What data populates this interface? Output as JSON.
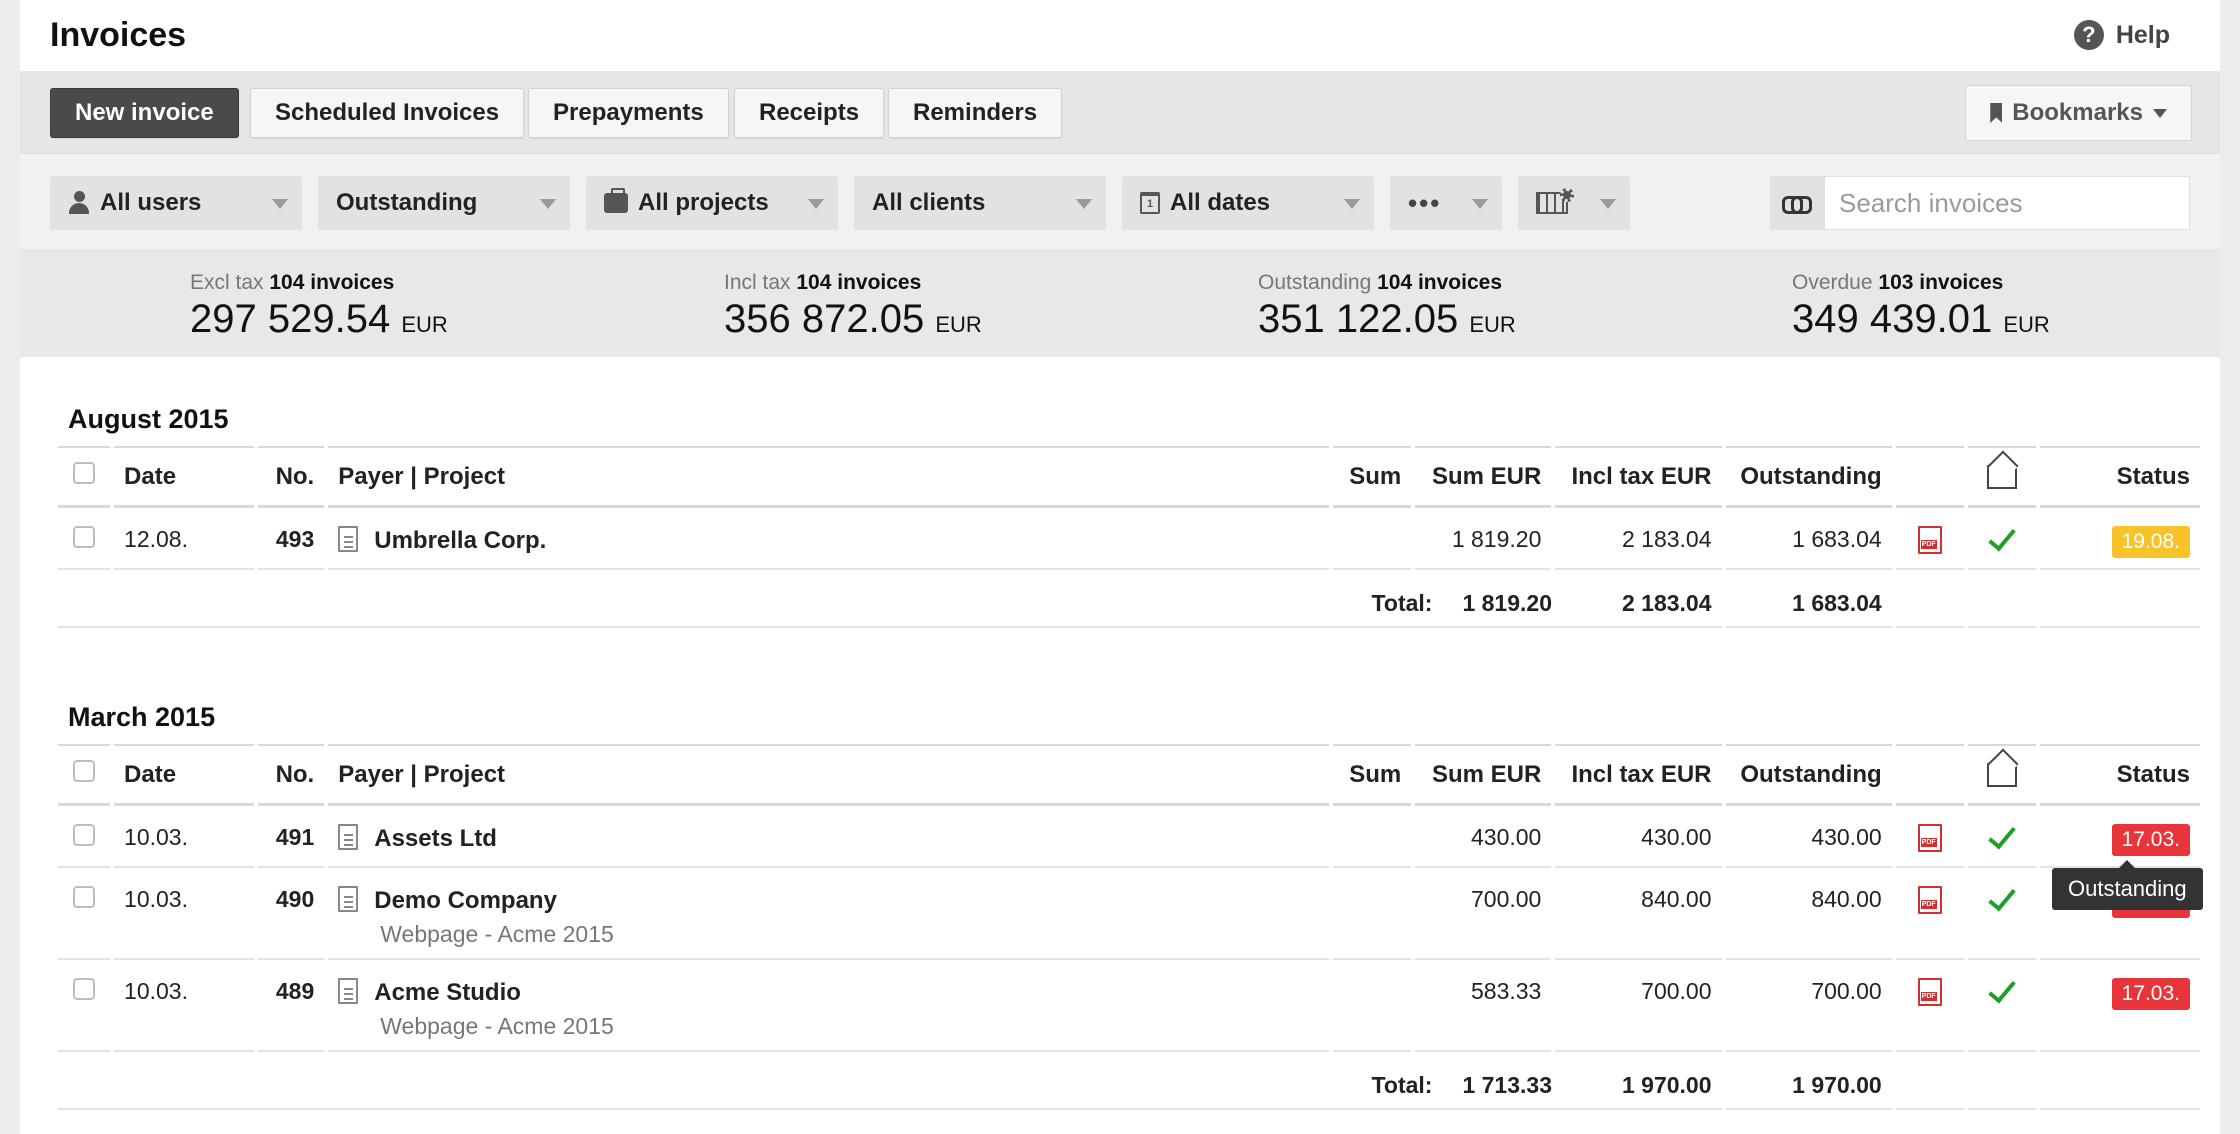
{
  "app": {
    "title": "Invoices",
    "help_label": "Help"
  },
  "tabs": [
    "New invoice",
    "Scheduled Invoices",
    "Prepayments",
    "Receipts",
    "Reminders"
  ],
  "bookmarks_label": "Bookmarks",
  "filters": {
    "users": "All users",
    "status": "Outstanding",
    "projects": "All projects",
    "clients": "All clients",
    "dates": "All dates",
    "more": "•••"
  },
  "search": {
    "placeholder": "Search invoices"
  },
  "summary": [
    {
      "label": "Excl tax",
      "count": "104 invoices",
      "value": "297 529.54",
      "currency": "EUR"
    },
    {
      "label": "Incl tax",
      "count": "104 invoices",
      "value": "356 872.05",
      "currency": "EUR"
    },
    {
      "label": "Outstanding",
      "count": "104 invoices",
      "value": "351 122.05",
      "currency": "EUR"
    },
    {
      "label": "Overdue",
      "count": "103 invoices",
      "value": "349 439.01",
      "currency": "EUR"
    }
  ],
  "columns": {
    "date": "Date",
    "no": "No.",
    "payer": "Payer | Project",
    "sum": "Sum",
    "sum_eur": "Sum EUR",
    "incl": "Incl tax EUR",
    "outstanding": "Outstanding",
    "status": "Status"
  },
  "total_label": "Total:",
  "sections": [
    {
      "title": "August 2015",
      "rows": [
        {
          "date": "12.08.",
          "no": "493",
          "payer": "Umbrella Corp.",
          "project": "",
          "sum": "",
          "sum_eur": "1 819.20",
          "incl": "2 183.04",
          "outstanding": "1 683.04",
          "status": "19.08.",
          "status_color": "#f7c32a"
        }
      ],
      "total": {
        "sum_eur": "1 819.20",
        "incl": "2 183.04",
        "outstanding": "1 683.04"
      }
    },
    {
      "title": "March 2015",
      "rows": [
        {
          "date": "10.03.",
          "no": "491",
          "payer": "Assets Ltd",
          "project": "",
          "sum": "",
          "sum_eur": "430.00",
          "incl": "430.00",
          "outstanding": "430.00",
          "status": "17.03.",
          "status_color": "#e8353b"
        },
        {
          "date": "10.03.",
          "no": "490",
          "payer": "Demo Company",
          "project": "Webpage - Acme 2015",
          "sum": "",
          "sum_eur": "700.00",
          "incl": "840.00",
          "outstanding": "840.00",
          "status": "17.03.",
          "status_color": "#e8353b"
        },
        {
          "date": "10.03.",
          "no": "489",
          "payer": "Acme Studio",
          "project": "Webpage - Acme 2015",
          "sum": "",
          "sum_eur": "583.33",
          "incl": "700.00",
          "outstanding": "700.00",
          "status": "17.03.",
          "status_color": "#e8353b"
        }
      ],
      "total": {
        "sum_eur": "1 713.33",
        "incl": "1 970.00",
        "outstanding": "1 970.00"
      }
    }
  ],
  "tooltip": "Outstanding"
}
